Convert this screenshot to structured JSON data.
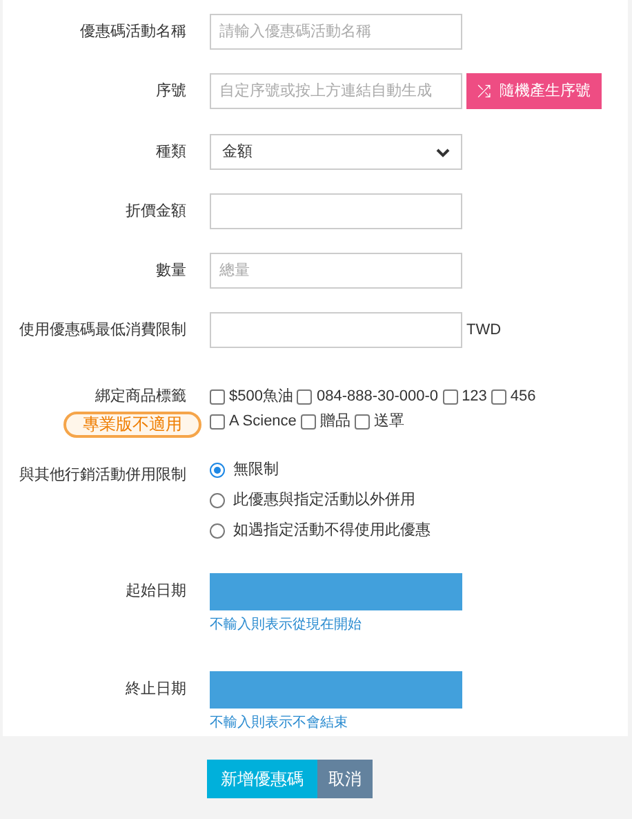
{
  "fields": [
    {
      "kind": "text",
      "label": "優惠碼活動名稱",
      "placeholder": "請輸入優惠碼活動名稱"
    },
    {
      "kind": "text-button",
      "label": "序號",
      "placeholder": "自定序號或按上方連結自動生成",
      "button": {
        "icon": "⤮",
        "label": "隨機產生序號"
      }
    },
    {
      "kind": "select",
      "label": "種類",
      "value": "金額"
    },
    {
      "kind": "text",
      "label": "折價金額"
    },
    {
      "kind": "text",
      "label": "數量",
      "placeholder": "總量"
    },
    {
      "kind": "text-suffix",
      "label": "使用優惠碼最低消費限制",
      "suffix": "TWD"
    },
    {
      "kind": "checkboxes",
      "label": "綁定商品標籤",
      "badge": "專業版不適用",
      "options": [
        {
          "label": "$500魚油",
          "checked": false
        },
        {
          "label": "084-888-30-000-0",
          "checked": false
        },
        {
          "label": "123",
          "checked": false
        },
        {
          "label": "456",
          "checked": false
        },
        {
          "label": "A Science",
          "checked": false
        },
        {
          "label": "贈品",
          "checked": false
        },
        {
          "label": "送罩",
          "checked": false
        }
      ]
    },
    {
      "kind": "radios",
      "label": "與其他行銷活動併用限制",
      "options": [
        {
          "label": "無限制",
          "selected": true
        },
        {
          "label": "此優惠與指定活動以外併用",
          "selected": false
        },
        {
          "label": "如遇指定活動不得使用此優惠",
          "selected": false
        }
      ]
    },
    {
      "kind": "date",
      "label": "起始日期",
      "hint": "不輸入則表示從現在開始"
    },
    {
      "kind": "date",
      "label": "終止日期",
      "hint": "不輸入則表示不會結束"
    }
  ],
  "actions": [
    {
      "kind": "primary",
      "label": "新增優惠碼"
    },
    {
      "kind": "secondary",
      "label": "取消"
    }
  ]
}
